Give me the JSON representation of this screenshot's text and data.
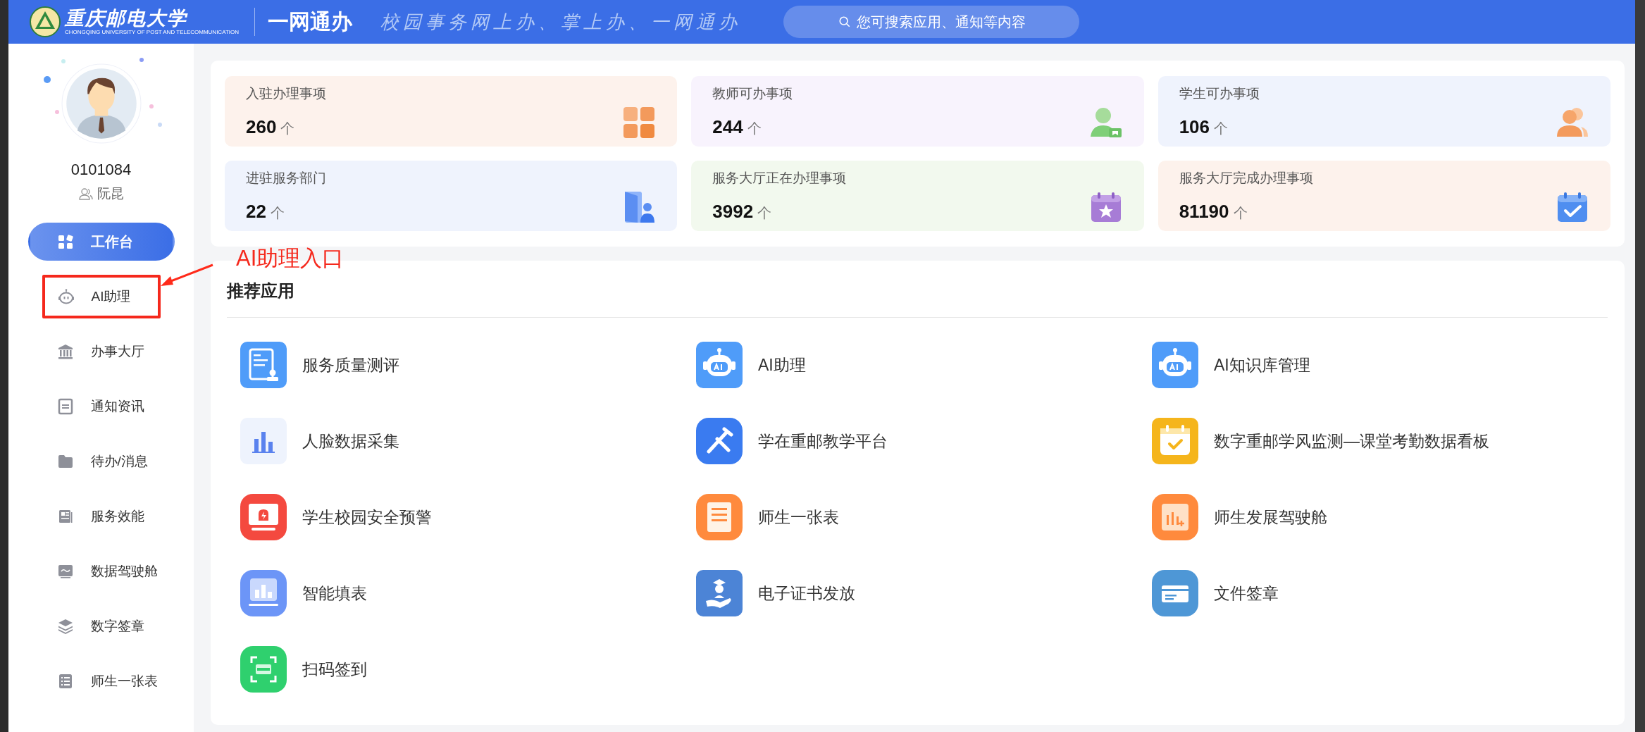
{
  "header": {
    "logo_title": "重庆邮电大学",
    "logo_subtitle": "CHONGQING UNIVERSITY OF POST AND TELECOMMUNICATION",
    "app_name": "一网通办",
    "slogan": "校园事务网上办、掌上办、一网通办",
    "search": {
      "placeholder": "您可搜索应用、通知等内容"
    }
  },
  "user": {
    "id": "0101084",
    "name": "阮昆"
  },
  "sidebar": {
    "items": [
      {
        "label": "工作台",
        "selected": true,
        "highlighted": false
      },
      {
        "label": "AI助理",
        "selected": false,
        "highlighted": true
      },
      {
        "label": "办事大厅",
        "selected": false,
        "highlighted": false
      },
      {
        "label": "通知资讯",
        "selected": false,
        "highlighted": false
      },
      {
        "label": "待办/消息",
        "selected": false,
        "highlighted": false
      },
      {
        "label": "服务效能",
        "selected": false,
        "highlighted": false
      },
      {
        "label": "数据驾驶舱",
        "selected": false,
        "highlighted": false
      },
      {
        "label": "数字签章",
        "selected": false,
        "highlighted": false
      },
      {
        "label": "师生一张表",
        "selected": false,
        "highlighted": false
      }
    ]
  },
  "annotation": {
    "text": "AI助理入口"
  },
  "stats": [
    {
      "title": "入驻办理事项",
      "value": "260",
      "unit": "个",
      "color": "#fdf2ec"
    },
    {
      "title": "教师可办事项",
      "value": "244",
      "unit": "个",
      "color": "#f8f3fd"
    },
    {
      "title": "学生可办事项",
      "value": "106",
      "unit": "个",
      "color": "#eff3fd"
    },
    {
      "title": "进驻服务部门",
      "value": "22",
      "unit": "个",
      "color": "#eff3fd"
    },
    {
      "title": "服务大厅正在办理事项",
      "value": "3992",
      "unit": "个",
      "color": "#f2f9ee"
    },
    {
      "title": "服务大厅完成办理事项",
      "value": "81190",
      "unit": "个",
      "color": "#fdf2ec"
    }
  ],
  "recommended": {
    "title": "推荐应用",
    "apps": [
      {
        "name": "服务质量测评",
        "color": "#4f9cf9"
      },
      {
        "name": "AI助理",
        "color": "#4f9cf9"
      },
      {
        "name": "AI知识库管理",
        "color": "#4f9cf9"
      },
      {
        "name": "人脸数据采集",
        "color": "#eef3fd"
      },
      {
        "name": "学在重邮教学平台",
        "color": "#3a7bf0"
      },
      {
        "name": "数字重邮学风监测—课堂考勤数据看板",
        "color": "#f5b51c"
      },
      {
        "name": "学生校园安全预警",
        "color": "#f4493f"
      },
      {
        "name": "师生一张表",
        "color": "#ff8a3d"
      },
      {
        "name": "师生发展驾驶舱",
        "color": "#ff8a3d"
      },
      {
        "name": "智能填表",
        "color": "#6c95f7"
      },
      {
        "name": "电子证书发放",
        "color": "#4c84d6"
      },
      {
        "name": "文件签章",
        "color": "#4e97d6"
      },
      {
        "name": "扫码签到",
        "color": "#2fd06e"
      }
    ]
  }
}
